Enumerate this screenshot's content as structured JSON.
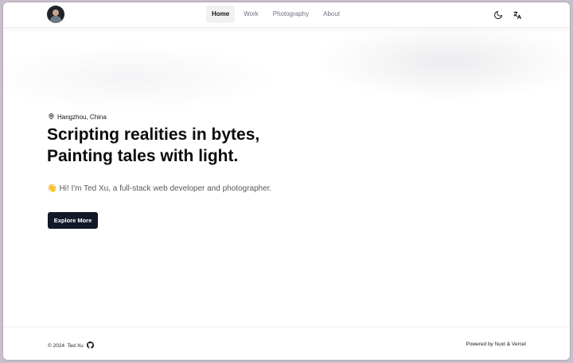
{
  "header": {
    "avatar_label": "Ted Xu avatar",
    "nav": [
      {
        "label": "Home",
        "active": true
      },
      {
        "label": "Work",
        "active": false
      },
      {
        "label": "Photography",
        "active": false
      },
      {
        "label": "About",
        "active": false
      }
    ],
    "icons": [
      "moon-icon",
      "translate-icon"
    ]
  },
  "hero": {
    "location": "Hangzhou, China",
    "headline_line1": "Scripting realities in bytes,",
    "headline_line2": "Painting tales with light.",
    "wave": "👋",
    "intro": "Hi! I'm Ted Xu, a full-stack web developer and photographer.",
    "cta_label": "Explore More"
  },
  "footer": {
    "copyright": "© 2024  Ted Xu",
    "powered_by": "Powered by Nuxt & Vercel"
  },
  "colors": {
    "accent": "#111827",
    "nav_active_bg": "#f1f1f3",
    "text_muted": "#55595f"
  }
}
